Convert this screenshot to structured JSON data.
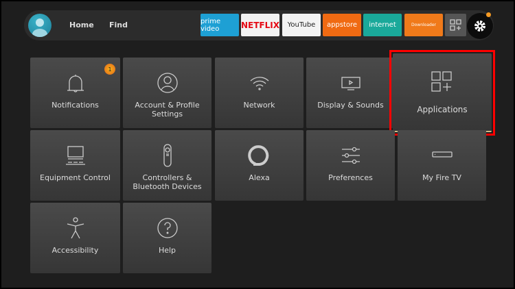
{
  "nav": {
    "home": "Home",
    "find": "Find",
    "apps": [
      {
        "label": "prime video",
        "color": "#1ea0d4",
        "text": "#ffffff"
      },
      {
        "label": "NETFLIX",
        "color": "#f3f3f3",
        "text": "#e50914"
      },
      {
        "label": "YouTube",
        "color": "#f3f3f3",
        "text": "#222222"
      },
      {
        "label": "appstore",
        "color": "#f06a12",
        "text": "#ffffff"
      },
      {
        "label": "internet",
        "color": "#1aa99a",
        "text": "#ffffff"
      },
      {
        "label": "Downloader",
        "color": "#f07a1a",
        "text": "#ffffff"
      }
    ],
    "all_apps_icon": "grid-plus-icon",
    "settings_icon": "gear-icon"
  },
  "tiles": [
    {
      "label": "Notifications",
      "icon": "bell-icon",
      "badge": "1"
    },
    {
      "label": "Account & Profile Settings",
      "icon": "user-icon"
    },
    {
      "label": "Network",
      "icon": "wifi-icon"
    },
    {
      "label": "Display & Sounds",
      "icon": "tv-icon"
    },
    {
      "label": "Applications",
      "icon": "grid-plus-icon",
      "selected": true
    },
    {
      "label": "Equipment Control",
      "icon": "computer-icon"
    },
    {
      "label": "Controllers & Bluetooth Devices",
      "icon": "remote-icon"
    },
    {
      "label": "Alexa",
      "icon": "alexa-icon"
    },
    {
      "label": "Preferences",
      "icon": "sliders-icon"
    },
    {
      "label": "My Fire TV",
      "icon": "firetv-stick-icon"
    },
    {
      "label": "Accessibility",
      "icon": "accessibility-icon"
    },
    {
      "label": "Help",
      "icon": "help-icon"
    }
  ],
  "colors": {
    "selection": "#ff0000",
    "badge": "#f59a23"
  }
}
